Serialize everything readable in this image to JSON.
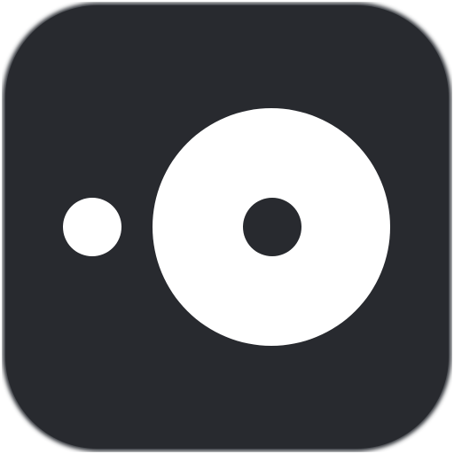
{
  "app_icon": {
    "icon_name": "camera-lens-icon",
    "colors": {
      "tile_background": "#282a2f",
      "tile_edge": "#2f3237",
      "glyph": "#ffffff",
      "lens_center": "#282a2f"
    }
  }
}
